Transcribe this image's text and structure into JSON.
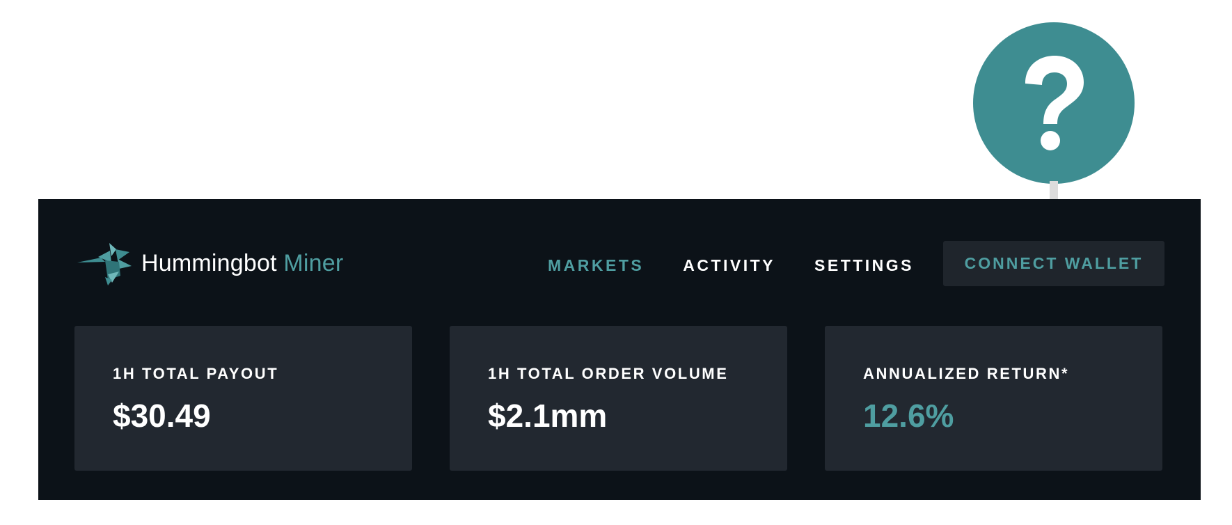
{
  "brand": {
    "name": "Hummingbot",
    "accent": "Miner",
    "logo_icon": "hummingbird-logo-icon"
  },
  "nav": {
    "items": [
      {
        "label": "MARKETS",
        "active": true
      },
      {
        "label": "ACTIVITY",
        "active": false
      },
      {
        "label": "SETTINGS",
        "active": false
      }
    ],
    "connect_wallet": "CONNECT WALLET"
  },
  "stats": [
    {
      "label": "1H TOTAL PAYOUT",
      "value": "$30.49"
    },
    {
      "label": "1H TOTAL ORDER VOLUME",
      "value": "$2.1mm"
    },
    {
      "label": "ANNUALIZED RETURN*",
      "value": "12.6%"
    }
  ],
  "callout": {
    "icon": "question-mark-icon",
    "arrow": "arrow-down-icon"
  },
  "colors": {
    "background": "#0c1218",
    "card": "#222830",
    "accent": "#4f9ea1",
    "callout": "#3e8d91",
    "text": "#ffffff"
  }
}
